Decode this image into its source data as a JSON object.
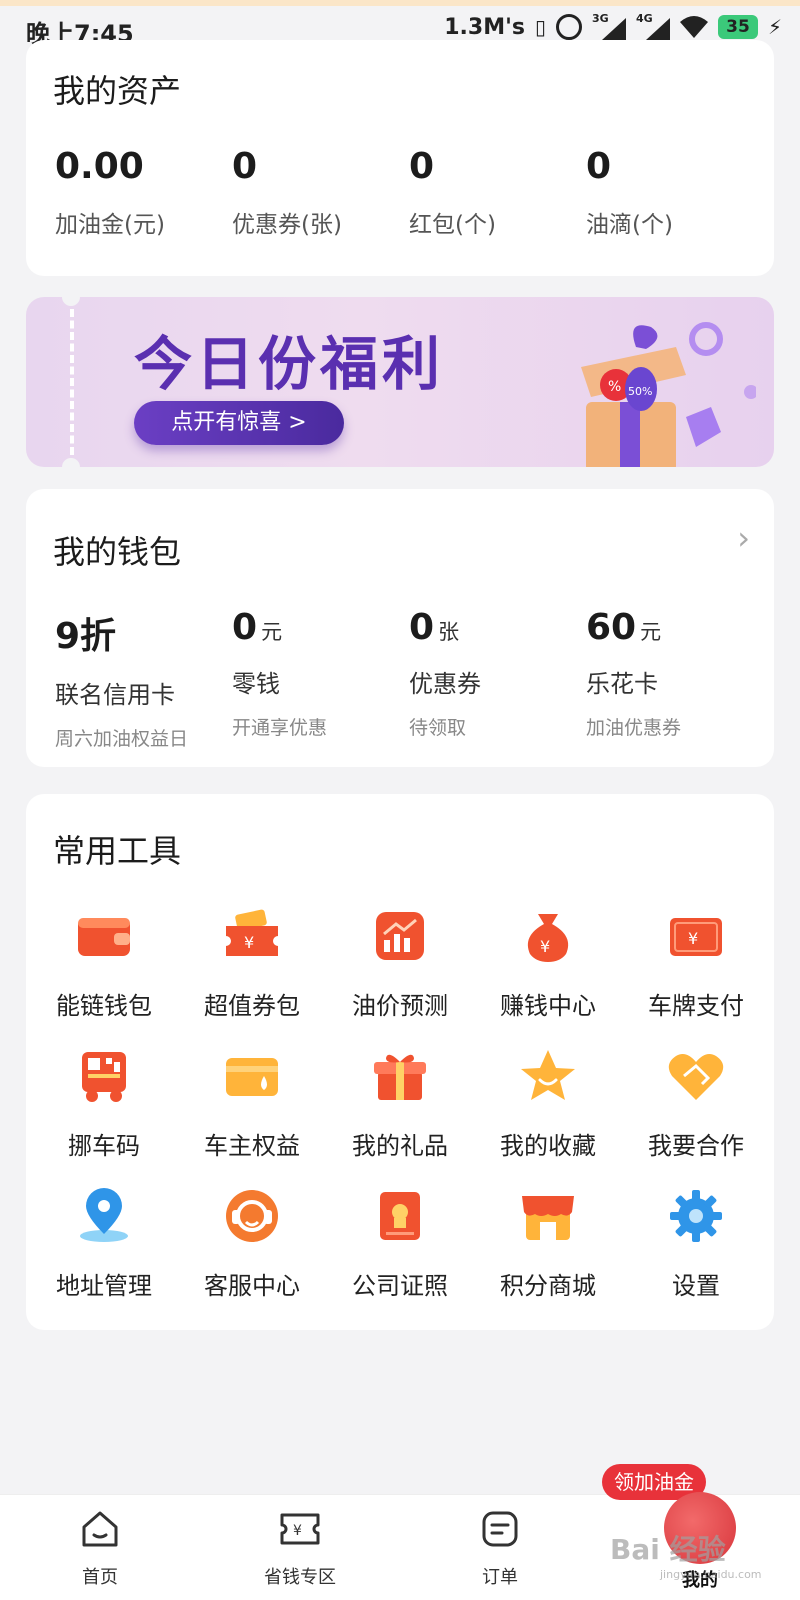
{
  "status_bar": {
    "time": "晚上7:45",
    "net_speed": "1.3M's",
    "sim1": "3G",
    "sim2": "4G",
    "battery": "35"
  },
  "assets": {
    "title": "我的资产",
    "items": [
      {
        "value": "0.00",
        "label": "加油金(元)"
      },
      {
        "value": "0",
        "label": "优惠券(张)"
      },
      {
        "value": "0",
        "label": "红包(个)"
      },
      {
        "value": "0",
        "label": "油滴(个)"
      }
    ]
  },
  "banner": {
    "title": "今日份福利",
    "button": "点开有惊喜 >",
    "badge": "50%"
  },
  "wallet": {
    "title": "我的钱包",
    "chevron": "›",
    "items": [
      {
        "value": "9折",
        "unit": "",
        "label": "联名信用卡",
        "sub": "周六加油权益日"
      },
      {
        "value": "0",
        "unit": "元",
        "label": "零钱",
        "sub": "开通享优惠"
      },
      {
        "value": "0",
        "unit": "张",
        "label": "优惠券",
        "sub": "待领取"
      },
      {
        "value": "60",
        "unit": "元",
        "label": "乐花卡",
        "sub": "加油优惠券"
      }
    ]
  },
  "tools": {
    "title": "常用工具",
    "items": [
      {
        "label": "能链钱包",
        "icon": "wallet-icon"
      },
      {
        "label": "超值券包",
        "icon": "coupon-icon"
      },
      {
        "label": "油价预测",
        "icon": "chart-icon"
      },
      {
        "label": "赚钱中心",
        "icon": "money-bag-icon"
      },
      {
        "label": "车牌支付",
        "icon": "plate-pay-icon"
      },
      {
        "label": "挪车码",
        "icon": "qr-car-icon"
      },
      {
        "label": "车主权益",
        "icon": "card-icon"
      },
      {
        "label": "我的礼品",
        "icon": "gift-icon"
      },
      {
        "label": "我的收藏",
        "icon": "star-icon"
      },
      {
        "label": "我要合作",
        "icon": "handshake-icon"
      },
      {
        "label": "地址管理",
        "icon": "location-icon"
      },
      {
        "label": "客服中心",
        "icon": "headset-icon"
      },
      {
        "label": "公司证照",
        "icon": "certificate-icon"
      },
      {
        "label": "积分商城",
        "icon": "shop-icon"
      },
      {
        "label": "设置",
        "icon": "gear-icon"
      }
    ]
  },
  "nav": {
    "promo": "领加油金",
    "items": [
      {
        "label": "首页",
        "icon": "home-icon"
      },
      {
        "label": "省钱专区",
        "icon": "savings-icon"
      },
      {
        "label": "订单",
        "icon": "order-icon"
      },
      {
        "label": "我的",
        "icon": "profile-icon"
      }
    ]
  },
  "watermark": {
    "text": "Bai 经验",
    "sub": "jingyan.baidu.com"
  },
  "colors": {
    "accent": "#e8323a",
    "banner_purple": "#5a2fb0",
    "icon_orange": "#f0522f"
  }
}
